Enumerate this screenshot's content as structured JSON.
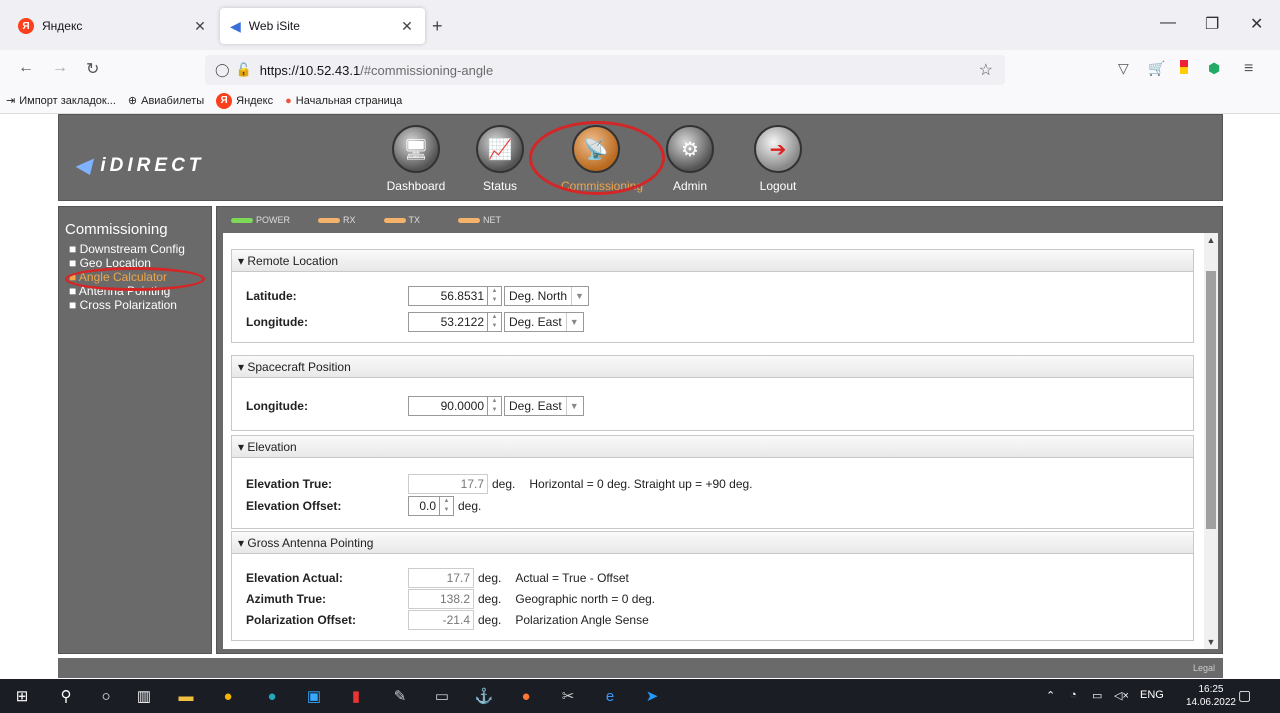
{
  "browser": {
    "tabs": [
      {
        "label": "Яндекс"
      },
      {
        "label": "Web iSite"
      }
    ],
    "url_host": "https://10.52.43.1",
    "url_rest": "/#commissioning-angle",
    "bookmarks": [
      "Импорт закладок...",
      "Авиабилеты",
      "Яндекс",
      "Начальная страница"
    ]
  },
  "header": {
    "logo_text": "iDIRECT",
    "nav": [
      {
        "label": "Dashboard",
        "icon": "monitor-icon"
      },
      {
        "label": "Status",
        "icon": "chart-icon"
      },
      {
        "label": "Commissioning",
        "icon": "satellite-dish-icon",
        "selected": true
      },
      {
        "label": "Admin",
        "icon": "gear-icon"
      },
      {
        "label": "Logout",
        "icon": "logout-door-icon"
      }
    ]
  },
  "sidebar": {
    "title": "Commissioning",
    "items": [
      {
        "label": "Downstream Config"
      },
      {
        "label": "Geo Location"
      },
      {
        "label": "Angle Calculator",
        "selected": true
      },
      {
        "label": "Antenna Pointing"
      },
      {
        "label": "Cross Polarization"
      }
    ]
  },
  "leds": [
    {
      "label": "POWER",
      "color": "#7ed957"
    },
    {
      "label": "RX",
      "color": "#f5b26b"
    },
    {
      "label": "TX",
      "color": "#f5b26b"
    },
    {
      "label": "NET",
      "color": "#f5b26b"
    }
  ],
  "sections": {
    "remote": {
      "title": "Remote Location",
      "latitude_label": "Latitude:",
      "latitude_value": "56.8531",
      "latitude_unit": "Deg. North",
      "longitude_label": "Longitude:",
      "longitude_value": "53.2122",
      "longitude_unit": "Deg. East"
    },
    "spacecraft": {
      "title": "Spacecraft Position",
      "longitude_label": "Longitude:",
      "longitude_value": "90.0000",
      "longitude_unit": "Deg. East"
    },
    "elevation": {
      "title": "Elevation",
      "true_label": "Elevation True:",
      "true_value": "17.7",
      "true_unit": "deg.",
      "true_note": "Horizontal = 0 deg. Straight up = +90 deg.",
      "offset_label": "Elevation Offset:",
      "offset_value": "0.0",
      "offset_unit": "deg."
    },
    "gross": {
      "title": "Gross Antenna Pointing",
      "elev_label": "Elevation Actual:",
      "elev_value": "17.7",
      "elev_unit": "deg.",
      "elev_note": "Actual = True - Offset",
      "az_label": "Azimuth True:",
      "az_value": "138.2",
      "az_unit": "deg.",
      "az_note": "Geographic north = 0 deg.",
      "pol_label": "Polarization Offset:",
      "pol_value": "-21.4",
      "pol_unit": "deg.",
      "pol_note": "Polarization Angle Sense"
    }
  },
  "footer": {
    "legal": "Legal"
  },
  "taskbar": {
    "lang": "ENG",
    "time": "16:25",
    "date": "14.06.2022"
  }
}
